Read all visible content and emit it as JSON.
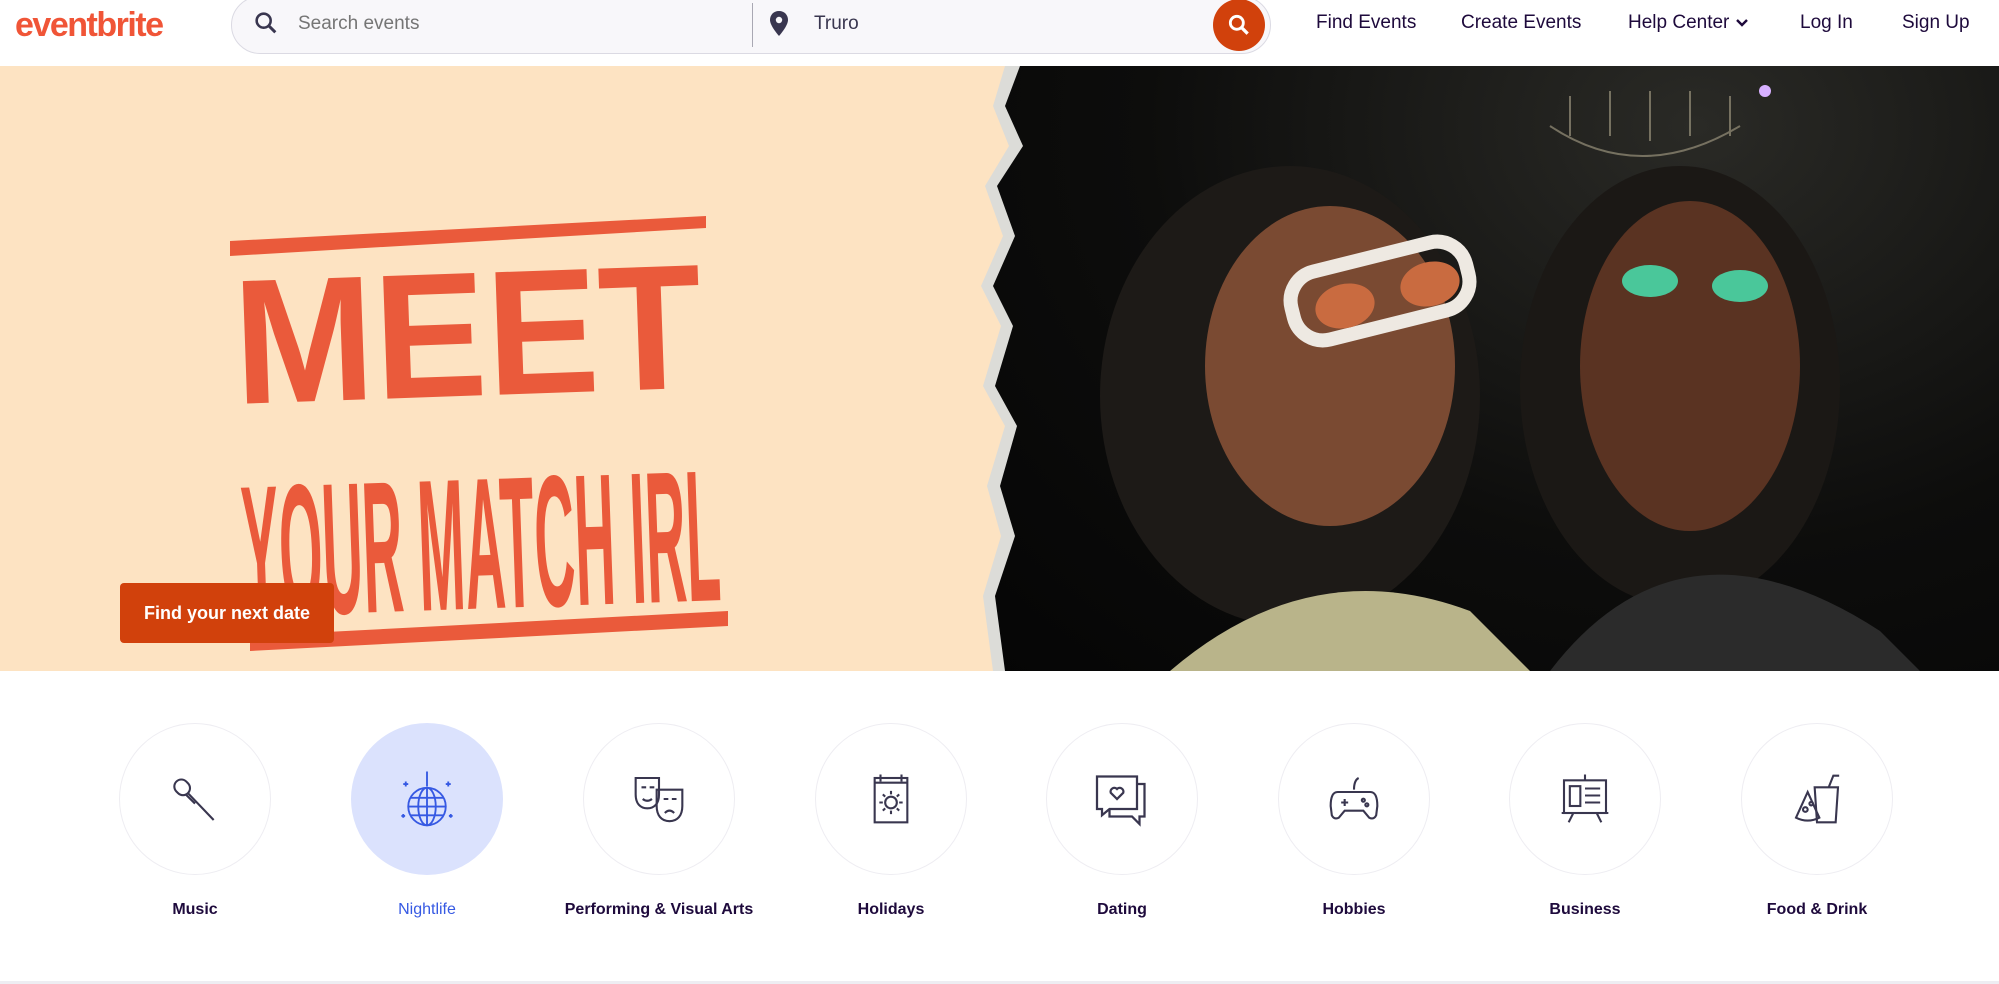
{
  "header": {
    "logo": "eventbrite",
    "search_placeholder": "Search events",
    "location_value": "Truro",
    "nav": [
      "Find Events",
      "Create Events",
      "Help Center",
      "Log In",
      "Sign Up"
    ]
  },
  "hero": {
    "headline_1": "MEET",
    "headline_2": "YOUR MATCH IRL",
    "cta": "Find your next date"
  },
  "categories": [
    {
      "label": "Music",
      "icon": "microphone-icon"
    },
    {
      "label": "Nightlife",
      "icon": "disco-ball-icon",
      "active": true
    },
    {
      "label": "Performing & Visual Arts",
      "icon": "theater-masks-icon"
    },
    {
      "label": "Holidays",
      "icon": "calendar-sun-icon"
    },
    {
      "label": "Dating",
      "icon": "chat-heart-icon"
    },
    {
      "label": "Hobbies",
      "icon": "gamepad-icon"
    },
    {
      "label": "Business",
      "icon": "presentation-board-icon"
    },
    {
      "label": "Food & Drink",
      "icon": "food-drink-icon"
    }
  ],
  "colors": {
    "brand": "#f05537",
    "accent": "#d1410c",
    "active": "#3659e3",
    "active_bg": "#dbe2fd",
    "hero_bg": "#fde3c2",
    "headline": "#ea5a3b"
  }
}
